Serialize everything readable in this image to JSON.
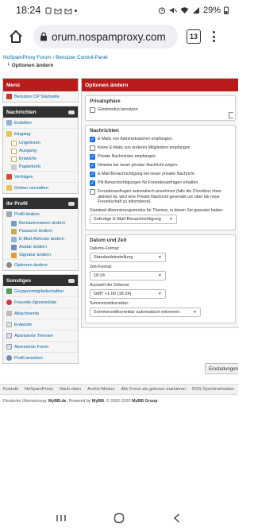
{
  "status": {
    "time": "18:24",
    "battery": "29%"
  },
  "browser": {
    "url": "orum.nospamproxy.com",
    "tab_count": "13"
  },
  "breadcrumb": {
    "items": [
      "NoSpamProxy Forum",
      "Benutzer Control-Panel"
    ],
    "separator": "›"
  },
  "page_title": "Optionen ändern",
  "sidebar": {
    "menu_label": "Menü",
    "home_link": "Benutzer CP Startseite",
    "messages": {
      "title": "Nachrichten",
      "items": [
        "Erstellen",
        "Eingang",
        "Ungelesen",
        "Ausgang",
        "Entwürfe",
        "Papierkorb",
        "Verfolgen",
        "Ordner verwalten"
      ]
    },
    "profile": {
      "title": "Ihr Profil",
      "items": [
        "Profil ändern",
        "Benutzernamen ändern",
        "Passwort ändern",
        "E-Mail-Adresse ändern",
        "Avatar ändern",
        "Signatur ändern",
        "Optionen ändern"
      ]
    },
    "misc": {
      "title": "Sonstiges",
      "items": [
        "Gruppenmitgliedschaften",
        "Freunde-/Ignorierliste",
        "Attachments",
        "Entwürfe",
        "Abonnierte Themen",
        "Abonnierte Foren",
        "Profil ansehen"
      ]
    }
  },
  "content": {
    "header": "Optionen ändern",
    "privacy": {
      "title": "Privatsphäre",
      "options": [
        {
          "label": "Geistmodus benutzen.",
          "checked": false
        }
      ]
    },
    "messages": {
      "title": "Nachrichten",
      "options": [
        {
          "label": "E-Mails von Administrator/en empfangen.",
          "checked": true
        },
        {
          "label": "Keine E-Mails von anderen Mitgliedern empfangen.",
          "checked": false
        },
        {
          "label": "Private Nachrichten empfangen.",
          "checked": true
        },
        {
          "label": "Hinweis bei neuer privater Nachricht zeigen.",
          "checked": true
        },
        {
          "label": "E-Mail-Benachrichtigung bei neuer privater Nachricht.",
          "checked": true
        },
        {
          "label": "PN-Benachrichtigungen für Freundesanfragen erhalten.",
          "checked": true
        },
        {
          "label": "Freundesanfragen automatisch ansehmen (falls die Checkbox oben aktiviert ist, wird eine Private Nachricht gesendet um über die neue Freundschaft zu informieren).",
          "checked": false
        }
      ],
      "subscription_label": "Standard-Abonnierungsmodus für Themen, in denen Sie gepostet haben:",
      "subscription_value": "Sofortige E-Mail-Benachrichtigung"
    },
    "datetime": {
      "title": "Datum und Zeit",
      "date_format_label": "Datums-Format:",
      "date_format_value": "Standardeinstellung",
      "time_format_label": "Zeit-Format:",
      "time_format_value": "18:24",
      "timezone_label": "Auswahl der Zeitzone",
      "timezone_value": "GMT +1:00 (18:24)",
      "dst_label": "Sommerzeitkorrektur:",
      "dst_value": "Sommerzeitkorrektur automatisch erkennen"
    },
    "save_button": "Einstellungen speichern"
  },
  "footer": {
    "links": [
      "Kontakt",
      "NoSpamProxy",
      "Nach oben",
      "Archiv-Modus",
      "Alle Foren als gelesen markieren",
      "RSS-Synchronisation"
    ],
    "credits_prefix": "Deutsche Übersetzung:",
    "credits_mybb_de": "MyBB.de",
    "credits_mid": ", Powered by",
    "credits_mybb": "MyBB",
    "credits_copy": ", © 2002-2022",
    "credits_group": "MyBB Group"
  }
}
